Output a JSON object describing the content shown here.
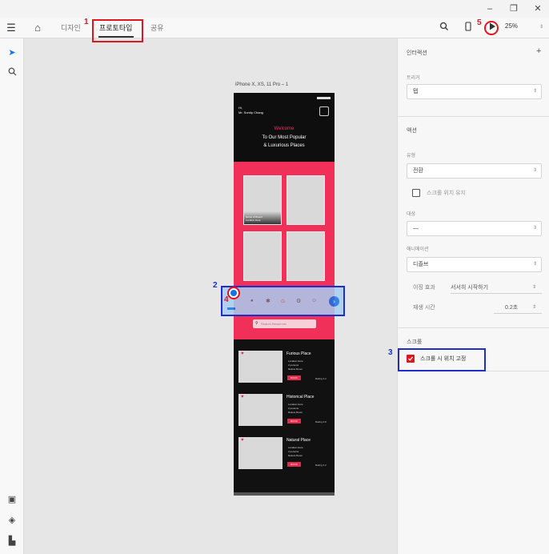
{
  "window": {
    "minimize": "–",
    "restore": "❐",
    "close": "✕"
  },
  "toolbar": {
    "tabs": [
      "디자인",
      "프로토타입",
      "공유"
    ],
    "zoom": "25%"
  },
  "annotations": {
    "n1": "1",
    "n2": "2",
    "n3": "3",
    "n4": "4",
    "n5": "5"
  },
  "artboard": {
    "label": "iPhone X, XS, 11 Pro – 1"
  },
  "phone": {
    "greeting_hi": "Hi,",
    "greeting_name": "Mr. Sontip Chang",
    "welcome": "Welcome",
    "tagline_1": "To Our Most Popular",
    "tagline_2": "& Luxurious Places",
    "thumb_caption_1": "Name of Resort",
    "thumb_caption_2": "Location Here",
    "search_placeholder": "Search Resort etc",
    "cards": [
      {
        "title": "Furious Place",
        "details": [
          "Location Here",
          "2 persons",
          "Deluxe Room"
        ],
        "button": "BOOK",
        "rating": "Rating 4.2"
      },
      {
        "title": "Historical Place",
        "details": [
          "Location Here",
          "2 persons",
          "Deluxe Room"
        ],
        "button": "BOOK",
        "rating": "Rating 4.8"
      },
      {
        "title": "Natural Place",
        "details": [
          "Location Here",
          "2 persons",
          "Deluxe Room"
        ],
        "button": "BOOK",
        "rating": "Rating 4.2"
      }
    ]
  },
  "panel": {
    "interaction_title": "인터랙션",
    "add_symbol": "+",
    "trigger_label": "트리거",
    "trigger_value": "탭",
    "action_title": "액션",
    "type_label": "유형",
    "type_value": "전환",
    "preserve_scroll": "스크롤 위치 유지",
    "target_label": "대상",
    "target_value": "—",
    "animation_label": "애니메이션",
    "animation_value": "디졸브",
    "easing_label": "이징 효과",
    "easing_value": "서서히 시작하기",
    "duration_label": "재생 시간",
    "duration_value": "0.2초",
    "scroll_title": "스크롤",
    "fix_scroll": "스크롤 시 위치 고정"
  },
  "colors": {
    "accent_pink": "#f1305a",
    "annotation_red": "#e0161e",
    "annotation_blue": "#1d2fc8",
    "selection_blue": "#a9cdf2"
  }
}
